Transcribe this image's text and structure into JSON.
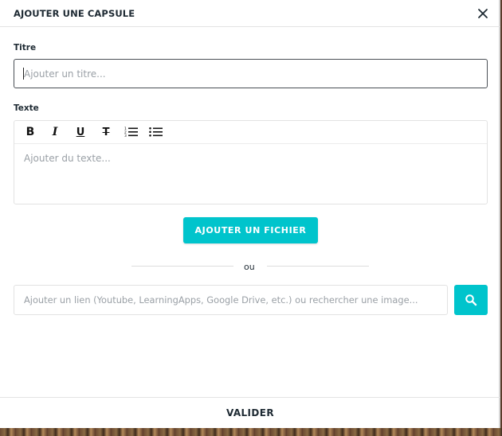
{
  "dialog": {
    "title": "AJOUTER UNE CAPSULE"
  },
  "title_field": {
    "label": "Titre",
    "placeholder": "Ajouter un titre...",
    "value": ""
  },
  "text_field": {
    "label": "Texte",
    "placeholder": "Ajouter du texte...",
    "toolbar": [
      {
        "name": "bold",
        "icon": "bold-icon",
        "glyph": "B"
      },
      {
        "name": "italic",
        "icon": "italic-icon",
        "glyph": "I"
      },
      {
        "name": "underline",
        "icon": "underline-icon",
        "glyph": "U"
      },
      {
        "name": "strikethrough",
        "icon": "strikethrough-icon",
        "glyph": "T"
      },
      {
        "name": "ordered-list",
        "icon": "ordered-list-icon"
      },
      {
        "name": "bullet-list",
        "icon": "bullet-list-icon"
      }
    ]
  },
  "file_button": {
    "label": "AJOUTER UN FICHIER"
  },
  "separator": {
    "text": "ou"
  },
  "link_field": {
    "placeholder": "Ajouter un lien (Youtube, LearningApps, Google Drive, etc.) ou rechercher une image...",
    "value": ""
  },
  "footer": {
    "validate_label": "VALIDER"
  },
  "colors": {
    "accent": "#00c4cc",
    "text": "#1e2a33",
    "placeholder": "#9aa0a6",
    "border": "#e2e2e2"
  }
}
